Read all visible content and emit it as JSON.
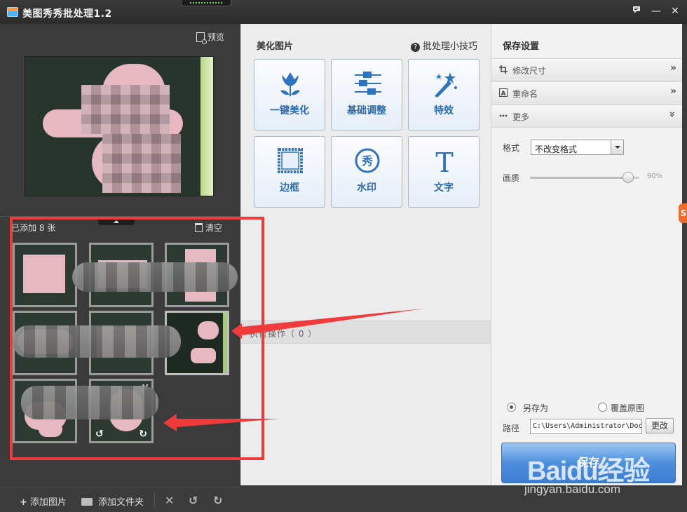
{
  "window": {
    "title": "美图秀秀批处理1.2",
    "feedback_icon": "feedback-icon",
    "minimize_glyph": "—",
    "close_glyph": "✕"
  },
  "left_panel": {
    "preview_label": "预览",
    "added_count": "已添加 8 张",
    "clear_label": "清空",
    "thumb_close": "✕",
    "thumb_rotate_left": "↺",
    "thumb_rotate_right": "↻",
    "add_image": "添加图片",
    "add_folder": "添加文件夹",
    "delete_glyph": "✕",
    "undo_glyph": "↺",
    "redo_glyph": "↻"
  },
  "middle_panel": {
    "title": "美化图片",
    "tips": "批处理小技巧",
    "tools": [
      {
        "label": "一键美化",
        "icon": "tulip-icon"
      },
      {
        "label": "基础调整",
        "icon": "sliders-icon"
      },
      {
        "label": "特效",
        "icon": "magic-wand-icon"
      },
      {
        "label": "边框",
        "icon": "frame-icon"
      },
      {
        "label": "水印",
        "icon": "watermark-stamp-icon"
      },
      {
        "label": "文字",
        "icon": "text-t-icon"
      }
    ],
    "ops_label": "执行操作（ 0 ）"
  },
  "right_panel": {
    "title": "保存设置",
    "sections": [
      {
        "label": "修改尺寸",
        "icon": "crop-icon",
        "arrow": "»"
      },
      {
        "label": "重命名",
        "icon": "rename-icon",
        "arrow": "»"
      },
      {
        "label": "更多",
        "icon": "more-dots-icon",
        "arrow": "»"
      }
    ],
    "format_label": "格式",
    "format_value": "不改变格式",
    "quality_label": "画质",
    "quality_value": "90%",
    "quality_fraction": 0.9,
    "save_as": "另存为",
    "overwrite": "覆盖原图",
    "path_label": "路径",
    "path_value": "C:\\Users\\Administrator\\Doc",
    "change_label": "更改",
    "save_label": "保存"
  },
  "watermark": {
    "main": "Baidu经验",
    "sub": "jingyan.baidu.com"
  },
  "colors": {
    "annotation_red": "#ef3b3b",
    "save_button_blue": "#4d8fdc",
    "accent_text_blue": "#2e6aa8"
  }
}
